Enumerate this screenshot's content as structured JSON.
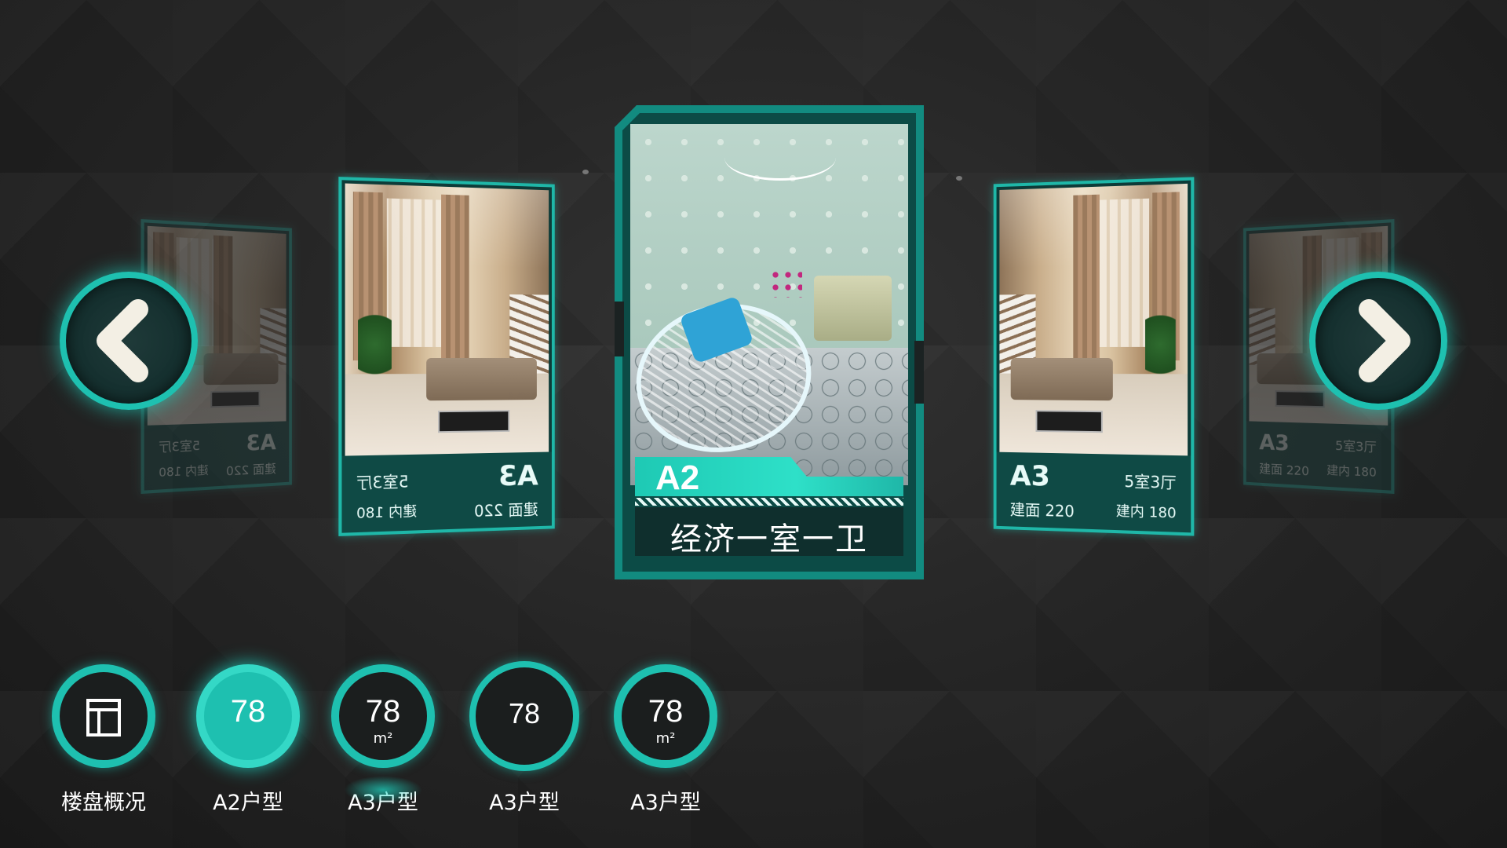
{
  "nav": {
    "prev_icon": "chevron-left-icon",
    "next_icon": "chevron-right-icon"
  },
  "carousel": {
    "far_left": {
      "code": "A3",
      "rooms": "5室3厅",
      "area": "建面 220",
      "inner": "建内 180"
    },
    "left": {
      "code": "A3",
      "rooms": "5室3厅",
      "area": "建面 220",
      "inner": "建内 180"
    },
    "center": {
      "code": "A2",
      "title": "经济一室一卫"
    },
    "right": {
      "code": "A3",
      "rooms": "5室3厅",
      "area": "建面 220",
      "inner": "建内 180"
    },
    "far_right": {
      "code": "A3",
      "rooms": "5室3厅",
      "area": "建面 220",
      "inner": "建内 180"
    }
  },
  "menu": {
    "items": [
      {
        "label": "楼盘概况",
        "icon": "document-layout-icon"
      },
      {
        "label": "A2户型",
        "value": "78"
      },
      {
        "label": "A3户型",
        "value": "78",
        "unit": "m²"
      },
      {
        "label": "A3户型",
        "value": "78"
      },
      {
        "label": "A3户型",
        "value": "78",
        "unit": "m²"
      }
    ]
  },
  "colors": {
    "accent": "#1ec0b0",
    "background": "#222222",
    "panel": "#0f4a45"
  }
}
